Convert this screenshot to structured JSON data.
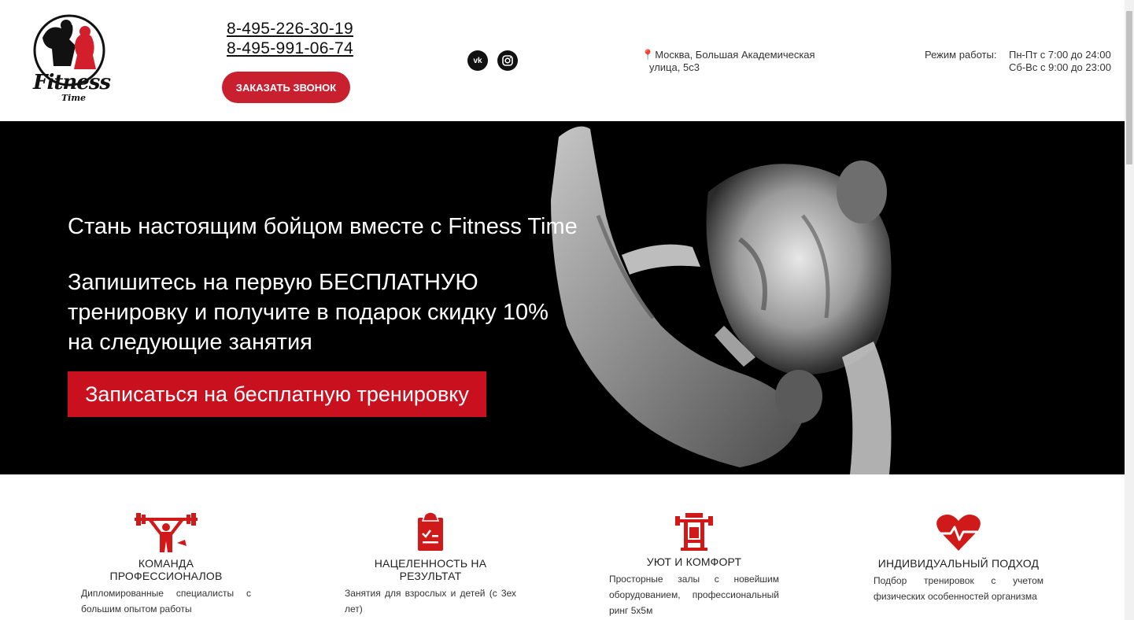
{
  "header": {
    "logo_text": "Fitness",
    "logo_subtext": "Time",
    "phones": [
      "8-495-226-30-19",
      "8-495-991-06-74"
    ],
    "callback_label": "Заказать звонок",
    "social": [
      {
        "name": "vk",
        "label": "vk"
      },
      {
        "name": "instagram",
        "label": "◎"
      }
    ],
    "address_line1": "Москва, Большая Академическая",
    "address_line2": "улица, 5с3",
    "hours_label": "Режим работы:",
    "hours_weekdays": "Пн-Пт с 7:00 до 24:00",
    "hours_weekend": "Сб-Вс  с 9:00 до 23:00"
  },
  "hero": {
    "title": "Стань настоящим бойцом вместе с Fitness Time",
    "offer_line1": "Запишитесь на первую БЕСПЛАТНУЮ",
    "offer_line2": "тренировку и получите в подарок скидку 10%",
    "offer_line3": "на следующие занятия",
    "cta_label": "Записаться на бесплатную тренировку"
  },
  "features": [
    {
      "icon": "weightlifter-icon",
      "title": "Команда профессионалов",
      "desc": "Дипломированные специалисты с большим опытом работы"
    },
    {
      "icon": "clipboard-check-icon",
      "title": "Нацеленность на результат",
      "desc": "Занятия для взрослых и детей (с 3ех лет)"
    },
    {
      "icon": "gym-machine-icon",
      "title": "Уют и комфорт",
      "desc": "Просторные залы с новейшим оборудованием, профессиональный ринг 5х5м"
    },
    {
      "icon": "heart-pulse-icon",
      "title": "Индивидуальный подход",
      "desc": "Подбор тренировок с учетом физических особенностей организма"
    }
  ],
  "colors": {
    "accent": "#c8101e",
    "button": "#c8202f",
    "hero_bg": "#000000"
  }
}
